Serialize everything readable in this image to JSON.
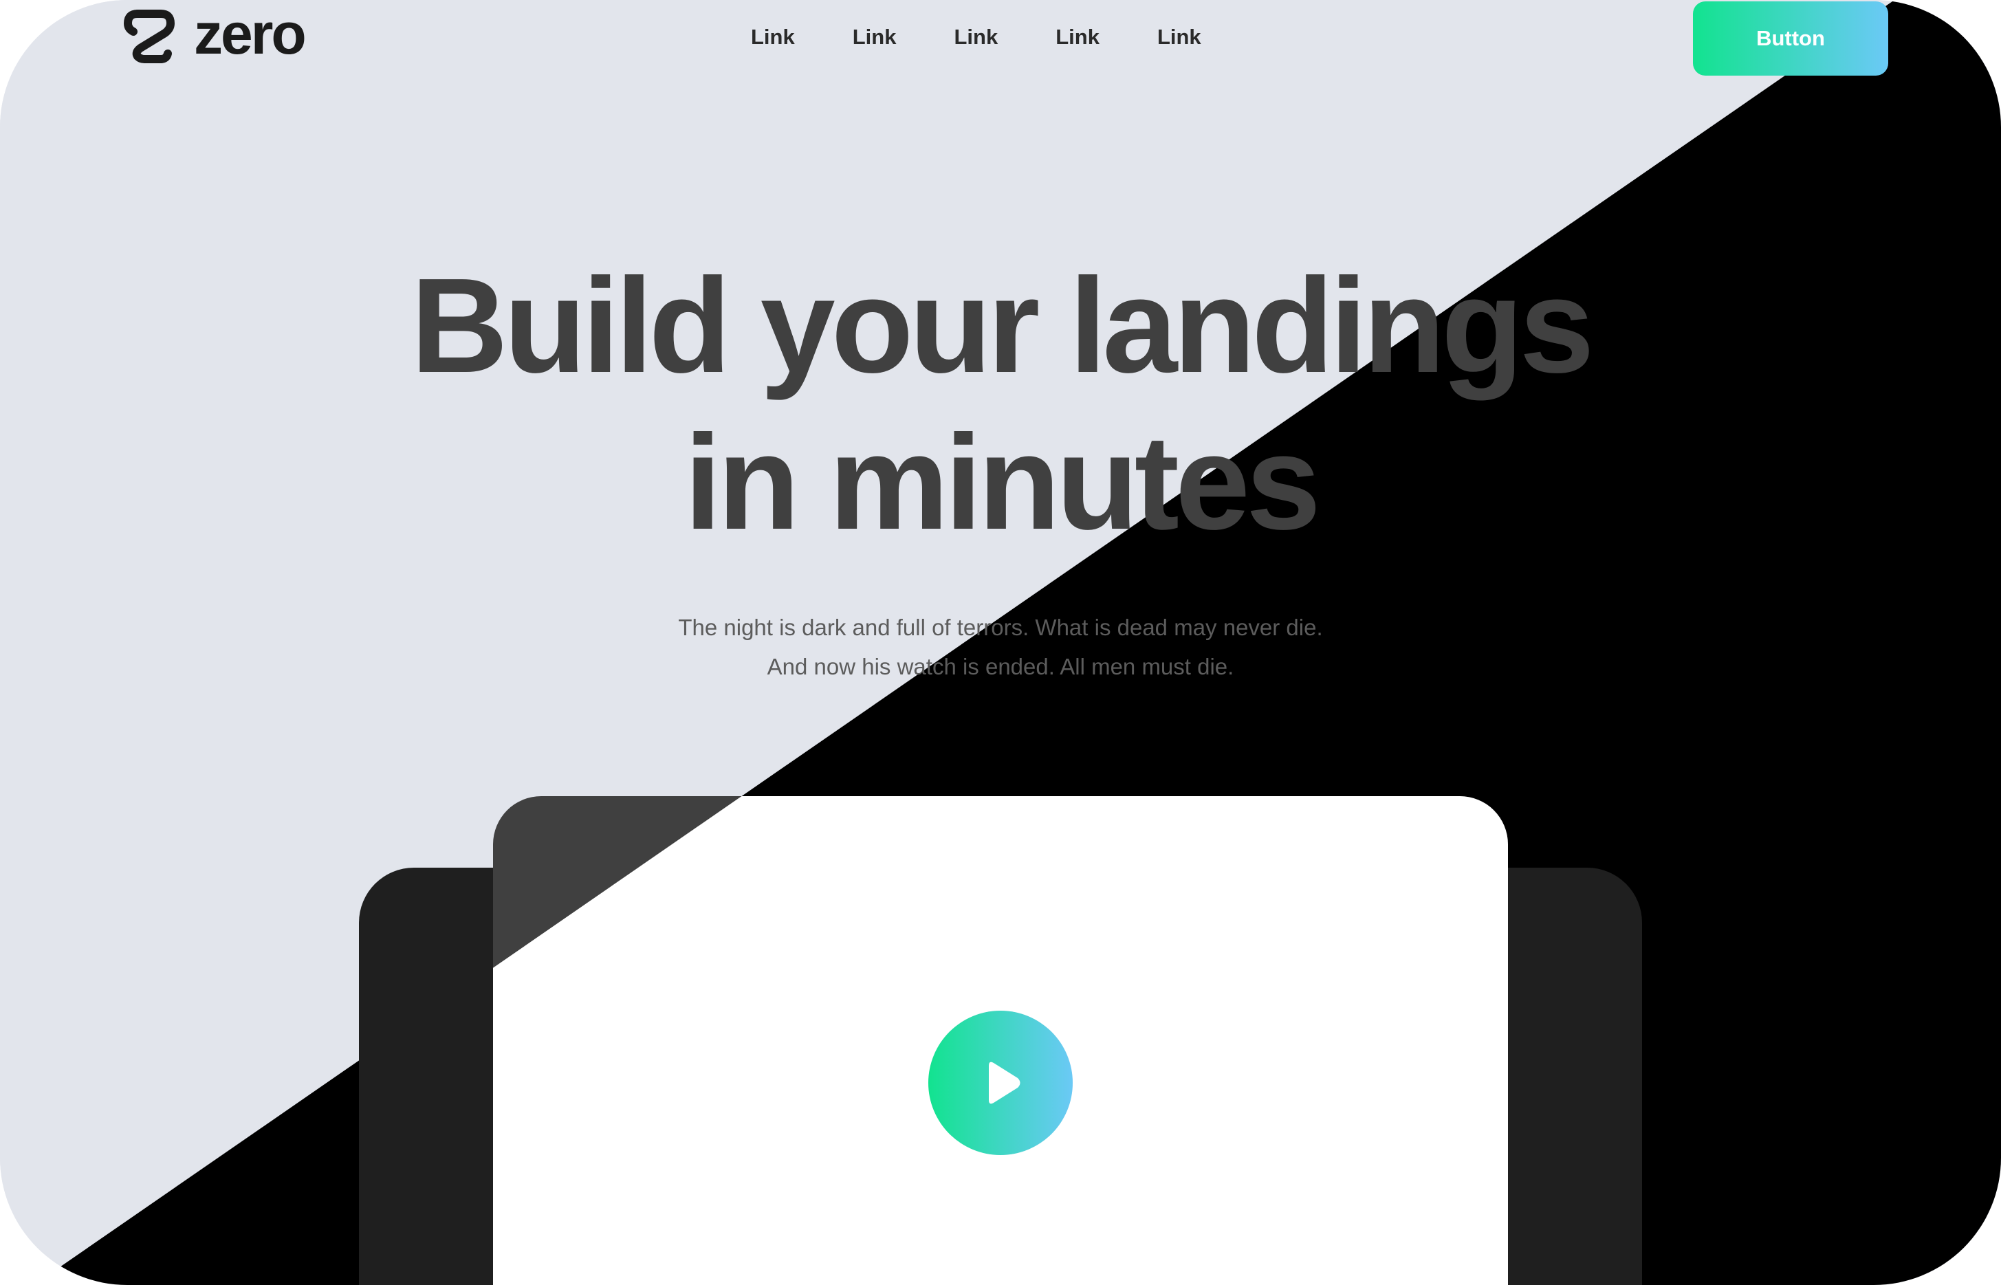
{
  "brand": {
    "name": "zero",
    "logo_icon": "logo-s-mark-icon"
  },
  "nav": {
    "links": [
      "Link",
      "Link",
      "Link",
      "Link",
      "Link"
    ]
  },
  "cta": {
    "label": "Button"
  },
  "hero": {
    "title_line1": "Build your landings",
    "title_line2": "in minutes",
    "subtitle_line1": "The night is dark and full of terrors. What is dead may never die.",
    "subtitle_line2": "And now his watch is ended. All men must die."
  },
  "media": {
    "play_icon": "play-icon"
  },
  "colors": {
    "background_light": "#e2e5ec",
    "background_dark": "#000000",
    "card_side": "#1f1f1f",
    "card_back": "#404040",
    "card_front": "#ffffff",
    "gradient_start": "#12e38f",
    "gradient_end": "#6bc9f6",
    "heading_text": "#404040"
  }
}
